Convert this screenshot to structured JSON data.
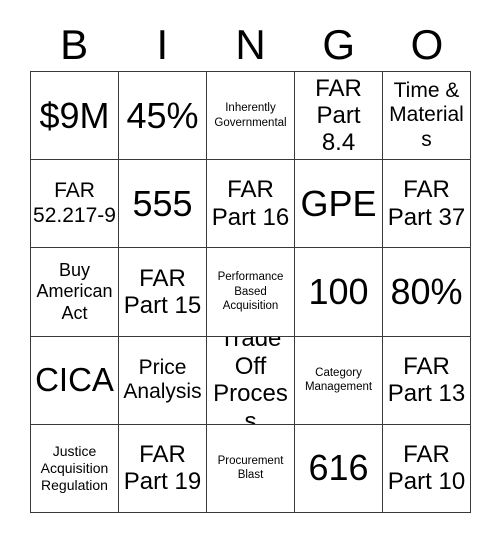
{
  "card": {
    "header_letters": [
      "B",
      "I",
      "N",
      "G",
      "O"
    ],
    "columns": 5,
    "rows": 5,
    "border_color": "#3a3a3a",
    "background_color": "#ffffff",
    "text_color": "#000000",
    "cells": [
      [
        {
          "text": "$9M",
          "size": "xxl"
        },
        {
          "text": "45%",
          "size": "xxl"
        },
        {
          "text": "Inherently Governmental",
          "size": "xxs"
        },
        {
          "text": "FAR Part 8.4",
          "size": "lg"
        },
        {
          "text": "Time & Materials",
          "size": "md"
        }
      ],
      [
        {
          "text": "FAR 52.217-9",
          "size": "md"
        },
        {
          "text": "555",
          "size": "xxl"
        },
        {
          "text": "FAR Part 16",
          "size": "lg"
        },
        {
          "text": "GPE",
          "size": "xxl"
        },
        {
          "text": "FAR Part 37",
          "size": "lg"
        }
      ],
      [
        {
          "text": "Buy American Act",
          "size": "sm"
        },
        {
          "text": "FAR Part 15",
          "size": "lg"
        },
        {
          "text": "Performance Based Acquisition",
          "size": "xxs"
        },
        {
          "text": "100",
          "size": "xxl"
        },
        {
          "text": "80%",
          "size": "xxl"
        }
      ],
      [
        {
          "text": "CICA",
          "size": "xl"
        },
        {
          "text": "Price Analysis",
          "size": "md"
        },
        {
          "text": "Trade Off Process",
          "size": "lg"
        },
        {
          "text": "Category Management",
          "size": "xxs"
        },
        {
          "text": "FAR Part 13",
          "size": "lg"
        }
      ],
      [
        {
          "text": "Justice Acquisition Regulation",
          "size": "xs"
        },
        {
          "text": "FAR Part 19",
          "size": "lg"
        },
        {
          "text": "Procurement Blast",
          "size": "xxs"
        },
        {
          "text": "616",
          "size": "xxl"
        },
        {
          "text": "FAR Part 10",
          "size": "lg"
        }
      ]
    ]
  }
}
